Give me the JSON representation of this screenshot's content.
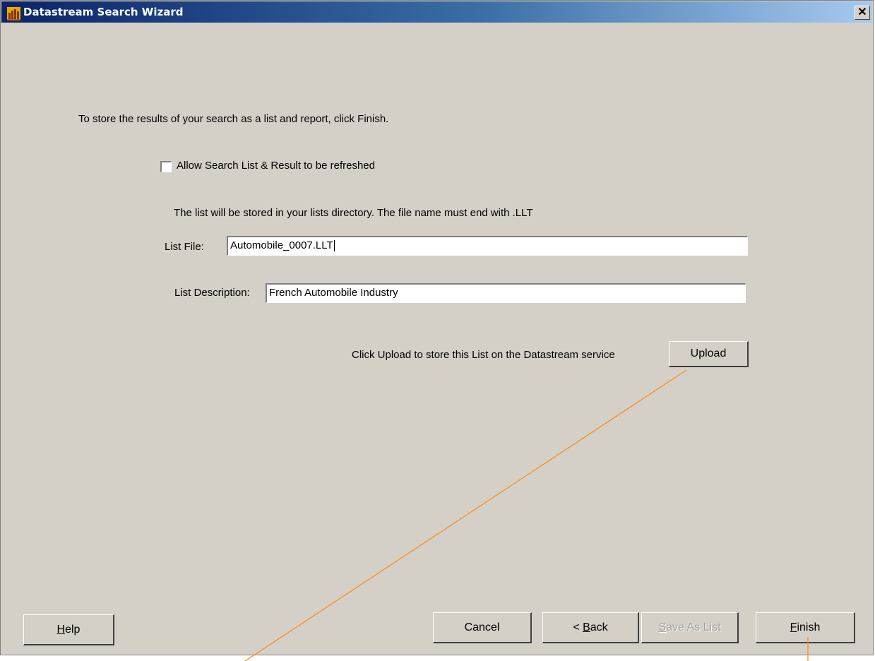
{
  "window": {
    "title": "Datastream Search Wizard",
    "close_glyph": "✕",
    "app_icon": "datastream-app-icon"
  },
  "content": {
    "instruction": "To store the results of your search as a list and report,  click Finish.",
    "refresh_checkbox": {
      "label": "Allow Search List & Result to be refreshed",
      "checked": false
    },
    "storage_note": "The list will be stored in your lists directory.  The file name must end with .LLT",
    "list_file": {
      "label": "List File:",
      "value": "Automobile_0007.LLT"
    },
    "list_description": {
      "label": "List Description:",
      "value": "French Automobile Industry"
    },
    "upload_note": "Click Upload to store this List on the Datastream service",
    "upload_label": "Upload"
  },
  "footer": {
    "help": {
      "mnemonic": "H",
      "rest": "elp"
    },
    "cancel_label": "Cancel",
    "back": {
      "prefix": "< ",
      "mnemonic": "B",
      "rest": "ack"
    },
    "save_as_list": {
      "mnemonic": "S",
      "rest": "ave As List",
      "disabled": true
    },
    "finish": {
      "mnemonic": "F",
      "rest": "inish"
    }
  },
  "colors": {
    "annotation_line": "#ff8c1a",
    "face": "#d4d0c8"
  }
}
